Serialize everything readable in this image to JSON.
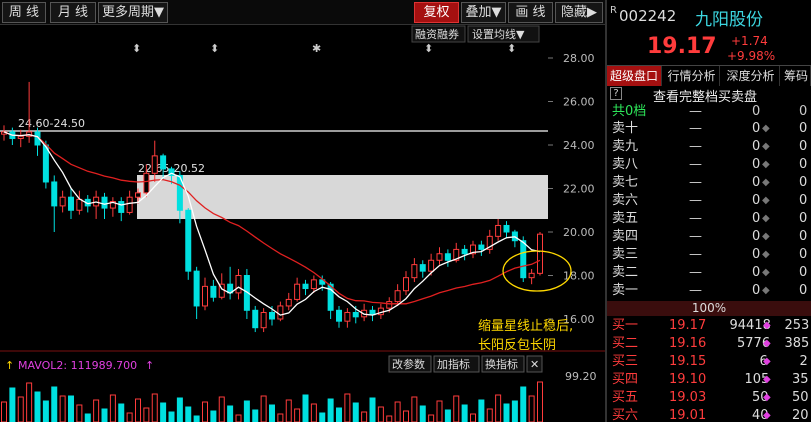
{
  "toolbar": {
    "left_buttons": [
      "周 线",
      "月 线",
      "更多周期▼"
    ],
    "right_buttons": [
      "复权",
      "叠加▼",
      "画 线",
      "隐藏▶"
    ],
    "active_right": "复权",
    "sub_buttons": [
      "融资融券",
      "设置均线▼"
    ]
  },
  "chart": {
    "price_axis": [
      "28.00",
      "26.00",
      "24.00",
      "22.00",
      "20.00",
      "18.00",
      "16.00"
    ],
    "range_labels": [
      "24.60-24.50",
      "22.65-20.52"
    ],
    "annotation_line1": "缩量星线止稳后,",
    "annotation_line2": "长阳反包长阴",
    "markers": [
      "⬍",
      "⬍",
      "⬍",
      "✱",
      "⬍",
      "⬍"
    ],
    "volume": {
      "indicator": "MAVOL2: 111989.700",
      "buttons": [
        "改参数",
        "加指标",
        "换指标",
        "✕"
      ],
      "axis_top": "99.20"
    },
    "colors": {
      "up": "#ff3c3c",
      "down": "#00e0e0",
      "ma1": "#ffffff",
      "ma2": "#e02020",
      "band": "#d8d8d8",
      "annotation": "#ffd800",
      "circle": "#ffd800"
    }
  },
  "chart_data": {
    "type": "candlestick",
    "ylim": [
      16.0,
      28.0
    ],
    "support_resistance": [
      {
        "label": "24.60-24.50",
        "value": 24.55
      },
      {
        "label": "22.65-20.52",
        "range": [
          20.52,
          22.65
        ]
      }
    ]
  },
  "quote": {
    "code": "002242",
    "name": "九阳股份",
    "price": "19.17",
    "change": "+1.74",
    "pct": "+9.98%",
    "tabs": [
      "超级盘口",
      "行情分析",
      "深度分析",
      "筹码"
    ],
    "active_tab": "超级盘口",
    "full_orderbook": "查看完整档买卖盘",
    "sell_total": "共0档",
    "sell_rows": [
      {
        "label": "卖十",
        "price": "—",
        "vol": "0",
        "cnt": "0"
      },
      {
        "label": "卖九",
        "price": "—",
        "vol": "0",
        "cnt": "0"
      },
      {
        "label": "卖八",
        "price": "—",
        "vol": "0",
        "cnt": "0"
      },
      {
        "label": "卖七",
        "price": "—",
        "vol": "0",
        "cnt": "0"
      },
      {
        "label": "卖六",
        "price": "—",
        "vol": "0",
        "cnt": "0"
      },
      {
        "label": "卖五",
        "price": "—",
        "vol": "0",
        "cnt": "0"
      },
      {
        "label": "卖四",
        "price": "—",
        "vol": "0",
        "cnt": "0"
      },
      {
        "label": "卖三",
        "price": "—",
        "vol": "0",
        "cnt": "0"
      },
      {
        "label": "卖二",
        "price": "—",
        "vol": "0",
        "cnt": "0"
      },
      {
        "label": "卖一",
        "price": "—",
        "vol": "0",
        "cnt": "0"
      }
    ],
    "ratio": "100%",
    "buy_rows": [
      {
        "label": "买一",
        "price": "19.17",
        "vol": "94418",
        "cnt": "253"
      },
      {
        "label": "买二",
        "price": "19.16",
        "vol": "5776",
        "cnt": "385"
      },
      {
        "label": "买三",
        "price": "19.15",
        "vol": "6",
        "cnt": "2"
      },
      {
        "label": "买四",
        "price": "19.10",
        "vol": "105",
        "cnt": "35"
      },
      {
        "label": "买五",
        "price": "19.03",
        "vol": "50",
        "cnt": "50"
      },
      {
        "label": "买六",
        "price": "19.01",
        "vol": "40",
        "cnt": "20"
      }
    ]
  }
}
